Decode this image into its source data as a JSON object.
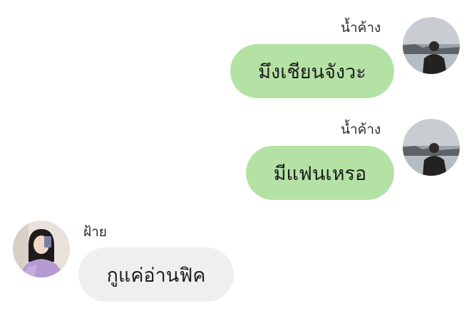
{
  "conversation": {
    "messages": [
      {
        "sender": "น้ำค้าง",
        "text": "มึงเชียนจังวะ",
        "direction": "outgoing",
        "avatar_icon": "sender-avatar-icon"
      },
      {
        "sender": "น้ำค้าง",
        "text": "มีแฟนเหรอ",
        "direction": "outgoing",
        "avatar_icon": "sender-avatar-icon"
      },
      {
        "sender": "ฝ้าย",
        "text": "กูแค่อ่านฟิค",
        "direction": "incoming",
        "avatar_icon": "receiver-avatar-icon"
      }
    ]
  },
  "colors": {
    "outgoing_bubble": "#b4e2a5",
    "incoming_bubble": "#efefef",
    "background": "#ffffff"
  }
}
